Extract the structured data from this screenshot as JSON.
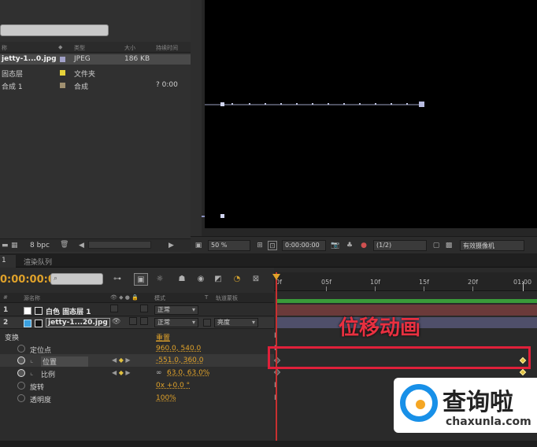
{
  "project": {
    "columns": {
      "name": "称",
      "type": "类型",
      "size": "大小",
      "duration": "持续时间"
    },
    "items": [
      {
        "name": "jetty-1...0.jpg",
        "color": "#a0a0c8",
        "type": "JPEG",
        "size": "186 KB",
        "duration": ""
      },
      {
        "name": "固态层",
        "color": "#e6d23a",
        "type": "文件夹",
        "size": "",
        "duration": ""
      },
      {
        "name": "合成 1",
        "color": "#a09070",
        "type": "合成",
        "size": "",
        "duration": "? 0:00"
      }
    ],
    "bpc": "8 bpc"
  },
  "viewer": {
    "zoom": "50 %",
    "timecode": "0:00:00:00",
    "resolution": "(1/2)",
    "camera": "有效摄像机"
  },
  "tabs": {
    "comp": "1",
    "render": "渲染队列"
  },
  "timeline": {
    "timecode": "0:00:00:00",
    "header": {
      "num": "#",
      "layer_name": "源名称",
      "mode": "模式",
      "t": "T",
      "track_matte": "轨道蒙板"
    },
    "ruler": [
      "0f",
      "05f",
      "10f",
      "15f",
      "20f",
      "01:00"
    ],
    "layers": [
      {
        "num": "1",
        "name": "白色 固态层 1",
        "mode": "正常"
      },
      {
        "num": "2",
        "name": "jetty-1...20.jpg",
        "mode": "正常",
        "track": "亮度"
      }
    ],
    "transform": {
      "label": "变换",
      "reset": "重置"
    },
    "properties": [
      {
        "label": "定位点",
        "value": "960.0, 540.0"
      },
      {
        "label": "位置",
        "value": "-551.0, 360.0"
      },
      {
        "label": "比例",
        "value": "63.0, 63.0%"
      },
      {
        "label": "旋转",
        "value": "0x +0.0 °"
      },
      {
        "label": "透明度",
        "value": "100%"
      }
    ]
  },
  "annotation": {
    "label": "位移动画"
  },
  "watermark": {
    "title": "查询啦",
    "domain": "chaxunla.com"
  },
  "colors": {
    "accent": "#e0a22a",
    "annotation": "#e0203a",
    "brand_blue": "#1890e8"
  }
}
